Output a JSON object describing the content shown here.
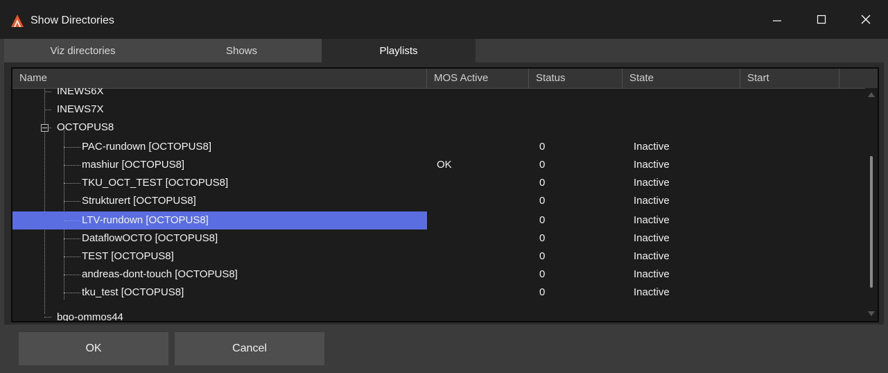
{
  "window": {
    "title": "Show Directories",
    "colors": {
      "titlebar": "#1f1f1f",
      "background": "#3b3b3b",
      "selection": "#5b6ee1",
      "logo": "#e8562a"
    }
  },
  "tabs": [
    {
      "label": "Viz directories",
      "active": false
    },
    {
      "label": "Shows",
      "active": false
    },
    {
      "label": "Playlists",
      "active": true
    }
  ],
  "columns": [
    "Name",
    "MOS Active",
    "Status",
    "State",
    "Start"
  ],
  "rows": [
    {
      "name": "INEWS6X",
      "mos": "",
      "status": "",
      "state": "",
      "start": ""
    },
    {
      "name": "INEWS7X",
      "mos": "",
      "status": "",
      "state": "",
      "start": ""
    },
    {
      "name": "OCTOPUS8",
      "mos": "",
      "status": "",
      "state": "",
      "start": "",
      "expanded": true
    },
    {
      "name": "PAC-rundown [OCTOPUS8]",
      "mos": "",
      "status": "0",
      "state": "Inactive",
      "start": ""
    },
    {
      "name": "mashiur [OCTOPUS8]",
      "mos": "OK",
      "status": "0",
      "state": "Inactive",
      "start": ""
    },
    {
      "name": "TKU_OCT_TEST [OCTOPUS8]",
      "mos": "",
      "status": "0",
      "state": "Inactive",
      "start": ""
    },
    {
      "name": "Strukturert [OCTOPUS8]",
      "mos": "",
      "status": "0",
      "state": "Inactive",
      "start": ""
    },
    {
      "name": "LTV-rundown [OCTOPUS8]",
      "mos": "",
      "status": "0",
      "state": "Inactive",
      "start": "",
      "selected": true
    },
    {
      "name": "DataflowOCTO [OCTOPUS8]",
      "mos": "",
      "status": "0",
      "state": "Inactive",
      "start": ""
    },
    {
      "name": "TEST [OCTOPUS8]",
      "mos": "",
      "status": "0",
      "state": "Inactive",
      "start": ""
    },
    {
      "name": "andreas-dont-touch [OCTOPUS8]",
      "mos": "",
      "status": "0",
      "state": "Inactive",
      "start": ""
    },
    {
      "name": "tku_test [OCTOPUS8]",
      "mos": "",
      "status": "0",
      "state": "Inactive",
      "start": ""
    },
    {
      "name": "bgo-ommos44",
      "mos": "",
      "status": "",
      "state": "",
      "start": ""
    }
  ],
  "buttons": {
    "ok": "OK",
    "cancel": "Cancel"
  },
  "icons": {
    "app": "vizrt-logo-icon",
    "minimize": "minimize-icon",
    "maximize": "maximize-icon",
    "close": "close-icon"
  }
}
